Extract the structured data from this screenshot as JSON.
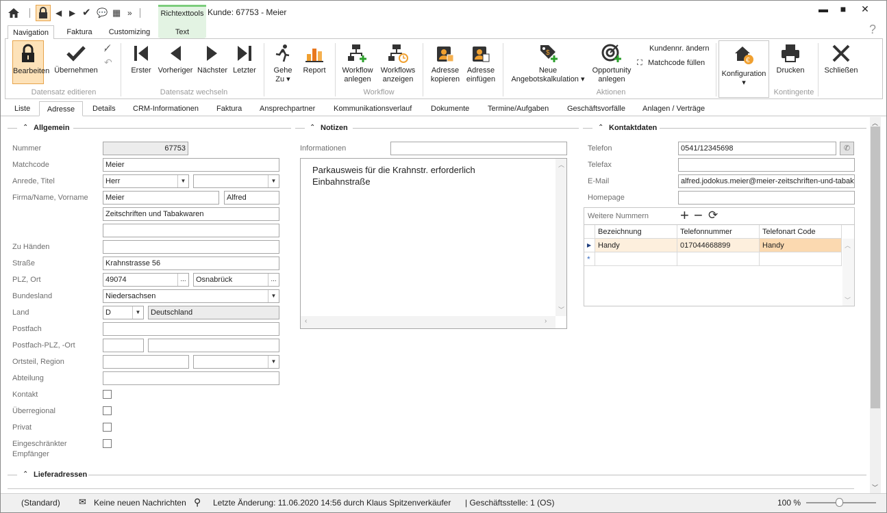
{
  "window": {
    "title": "Kunde: 67753 - Meier",
    "context_tab_group": "Richtexttools",
    "minimize": "▬",
    "maximize": "■",
    "close": "✕",
    "help": "?"
  },
  "ribbon_tabs": [
    "Navigation",
    "Faktura",
    "Customizing",
    "Text"
  ],
  "ribbon": {
    "bearbeiten": "Bearbeiten",
    "uebernehmen": "Übernehmen",
    "grp_datensatz": "Datensatz editieren",
    "erster": "Erster",
    "vorheriger": "Vorheriger",
    "naechster": "Nächster",
    "letzter": "Letzter",
    "grp_wechseln": "Datensatz wechseln",
    "gehe": "Gehe",
    "zu": "Zu ▾",
    "report": "Report",
    "workflow1": "Workflow",
    "workflow2": "anlegen",
    "workflows1": "Workflows",
    "workflows2": "anzeigen",
    "grp_workflow": "Workflow",
    "adr_kop1": "Adresse",
    "adr_kop2": "kopieren",
    "adr_einf1": "Adresse",
    "adr_einf2": "einfügen",
    "neue1": "Neue",
    "neue2": "Angebotskalkulation ▾",
    "opp1": "Opportunity",
    "opp2": "anlegen",
    "kundennr": "Kundennr. ändern",
    "matchcode": "Matchcode füllen",
    "grp_aktionen": "Aktionen",
    "konfig": "Konfiguration",
    "konfig_arrow": "▾",
    "drucken": "Drucken",
    "grp_kontingente": "Kontingente",
    "schliessen": "Schließen"
  },
  "subtabs": [
    "Liste",
    "Adresse",
    "Details",
    "CRM-Informationen",
    "Faktura",
    "Ansprechpartner",
    "Kommunikationsverlauf",
    "Dokumente",
    "Termine/Aufgaben",
    "Geschäftsvorfälle",
    "Anlagen / Verträge"
  ],
  "allgemein": {
    "title": "Allgemein",
    "nummer_label": "Nummer",
    "nummer": "67753",
    "matchcode_label": "Matchcode",
    "matchcode": "Meier",
    "anrede_label": "Anrede, Titel",
    "anrede": "Herr",
    "titel": "",
    "firma_label": "Firma/Name, Vorname",
    "name": "Meier",
    "vorname": "Alfred",
    "firma2": "Zeitschriften und Tabakwaren",
    "firma3": "",
    "zuhaenden_label": "Zu Händen",
    "zuhaenden": "",
    "strasse_label": "Straße",
    "strasse": "Krahnstrasse 56",
    "plz_label": "PLZ, Ort",
    "plz": "49074",
    "ort": "Osnabrück",
    "ellipsis": "...",
    "bundesland_label": "Bundesland",
    "bundesland": "Niedersachsen",
    "land_label": "Land",
    "land_code": "D",
    "land": "Deutschland",
    "postfach_label": "Postfach",
    "postfach": "",
    "postfach_plz_label": "Postfach-PLZ, -Ort",
    "ortsteil_label": "Ortsteil, Region",
    "abteilung_label": "Abteilung",
    "kontakt_label": "Kontakt",
    "ueberregional_label": "Überregional",
    "privat_label": "Privat",
    "eingeschraenkt_label1": "Eingeschränkter",
    "eingeschraenkt_label2": "Empfänger"
  },
  "notizen": {
    "title": "Notizen",
    "informationen_label": "Informationen",
    "informationen": "",
    "note_line1": "Parkausweis für die Krahnstr. erforderlich",
    "note_line2": "Einbahnstraße"
  },
  "kontaktdaten": {
    "title": "Kontaktdaten",
    "telefon_label": "Telefon",
    "telefon": "0541/12345698",
    "telefax_label": "Telefax",
    "telefax": "",
    "email_label": "E-Mail",
    "email": "alfred.jodokus.meier@meier-zeitschriften-und-tabakwaren.de",
    "homepage_label": "Homepage",
    "homepage": "",
    "weitere_label": "Weitere Nummern",
    "columns": [
      "Bezeichnung",
      "Telefonnummer",
      "Telefonart Code"
    ],
    "rows": [
      {
        "bezeichnung": "Handy",
        "nummer": "017044668899",
        "art": "Handy"
      }
    ]
  },
  "lieferadressen": {
    "title": "Lieferadressen"
  },
  "status": {
    "mode": "(Standard)",
    "messages": "Keine neuen Nachrichten",
    "last_change": "Letzte Änderung: 11.06.2020 14:56 durch Klaus Spitzenverkäufer",
    "branch": "| Geschäftsstelle:  1 (OS)",
    "zoom": "100 %"
  }
}
